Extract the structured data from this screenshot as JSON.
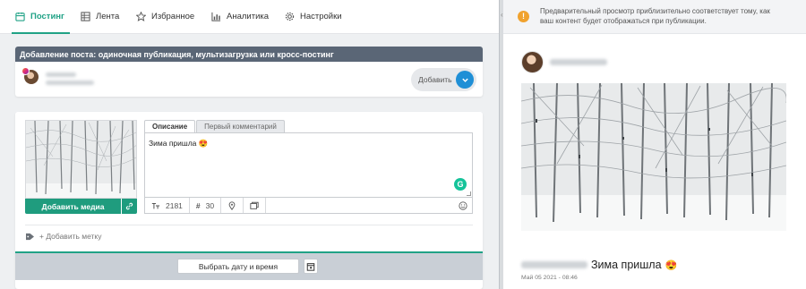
{
  "nav": {
    "tabs": [
      {
        "label": "Постинг",
        "active": true
      },
      {
        "label": "Лента"
      },
      {
        "label": "Избранное"
      },
      {
        "label": "Аналитика"
      },
      {
        "label": "Настройки"
      }
    ]
  },
  "composer": {
    "section_title": "Добавление поста: одиночная публикация, мультизагрузка или кросс-постинг",
    "add_button_label": "Добавить",
    "add_media_label": "Добавить медиа",
    "tabs": [
      "Описание",
      "Первый комментарий"
    ],
    "text": "Зима пришла",
    "text_emoji": "😍",
    "char_count": "2181",
    "hashtag_count": "30",
    "add_tag_label": "+ Добавить метку",
    "choose_date_label": "Выбрать дату и время"
  },
  "preview": {
    "notice": "Предварительный просмотр приблизительно соответствует тому, как ваш контент будет отображаться при публикации.",
    "caption_text": "Зима пришла",
    "caption_emoji": "😍",
    "date": "Май 05 2021 - 08:46"
  },
  "colors": {
    "accent": "#20a286",
    "header_bg": "#5a6676",
    "add_circle": "#1f8fd6",
    "warning": "#f0a22e"
  }
}
